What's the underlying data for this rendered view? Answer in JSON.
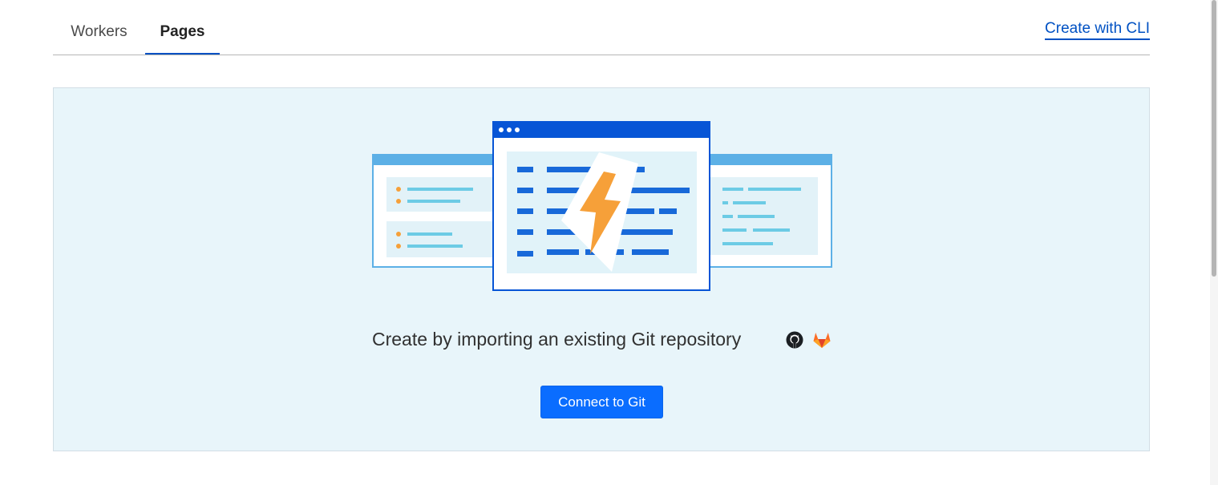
{
  "tabs": [
    {
      "label": "Workers",
      "active": false
    },
    {
      "label": "Pages",
      "active": true
    }
  ],
  "header": {
    "cli_link": "Create with CLI"
  },
  "empty_state": {
    "headline": "Create by importing an existing Git repository",
    "providers": [
      "github-icon",
      "gitlab-icon"
    ],
    "button_label": "Connect to Git"
  },
  "colors": {
    "accent": "#0051c3",
    "button": "#0a6dff",
    "panel_background": "#e8f5fa",
    "bolt": "#f6a039"
  }
}
